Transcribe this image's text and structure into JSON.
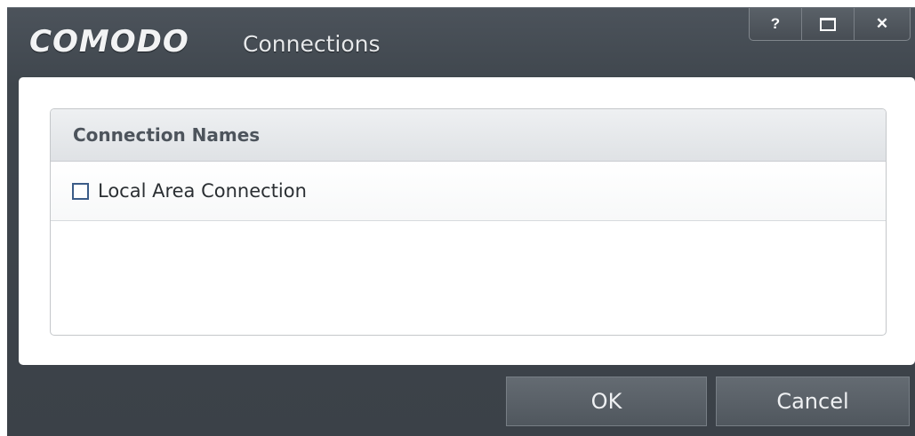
{
  "window": {
    "brand": "COMODO",
    "title": "Connections",
    "controls": {
      "help": "?",
      "close": "✕"
    }
  },
  "list": {
    "header": "Connection Names",
    "items": [
      {
        "label": "Local Area Connection",
        "checked": false
      }
    ]
  },
  "footer": {
    "ok_label": "OK",
    "cancel_label": "Cancel"
  }
}
